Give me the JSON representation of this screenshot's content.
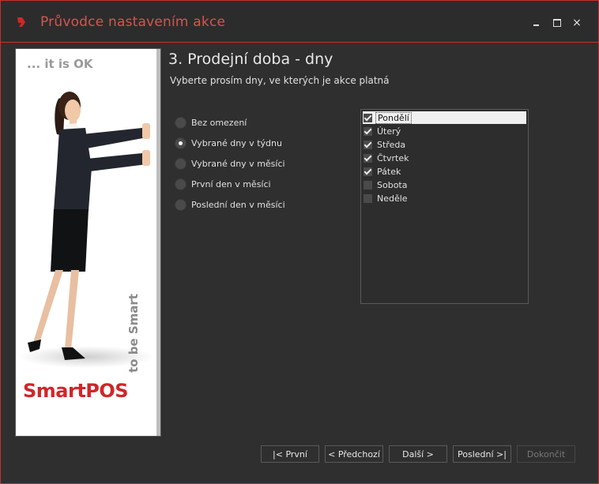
{
  "window": {
    "title": "Průvodce nastavením akce",
    "controls": {
      "minimize": "minimize-icon",
      "maximize": "maximize-icon",
      "close": "×"
    },
    "accent": "#c9302c"
  },
  "sidebar": {
    "slogan": "... it is OK",
    "vertical_text": "to be Smart",
    "brand": "SmartPOS"
  },
  "step": {
    "title": "3. Prodejní doba - dny",
    "subtitle": "Vyberte prosím dny, ve kterých je akce platná"
  },
  "options": [
    {
      "label": "Bez omezení",
      "checked": false
    },
    {
      "label": "Vybrané dny v týdnu",
      "checked": true
    },
    {
      "label": "Vybrané dny v měsíci",
      "checked": false
    },
    {
      "label": "První den v měsíci",
      "checked": false
    },
    {
      "label": "Poslední den v měsíci",
      "checked": false
    }
  ],
  "days": [
    {
      "label": "Pondělí",
      "checked": true,
      "selected": true
    },
    {
      "label": "Úterý",
      "checked": true,
      "selected": false
    },
    {
      "label": "Středa",
      "checked": true,
      "selected": false
    },
    {
      "label": "Čtvrtek",
      "checked": true,
      "selected": false
    },
    {
      "label": "Pátek",
      "checked": true,
      "selected": false
    },
    {
      "label": "Sobota",
      "checked": false,
      "selected": false
    },
    {
      "label": "Neděle",
      "checked": false,
      "selected": false
    }
  ],
  "buttons": {
    "first": "|< První",
    "prev": "< Předchozí",
    "next": "Další >",
    "last": "Poslední >|",
    "finish": "Dokončit"
  }
}
